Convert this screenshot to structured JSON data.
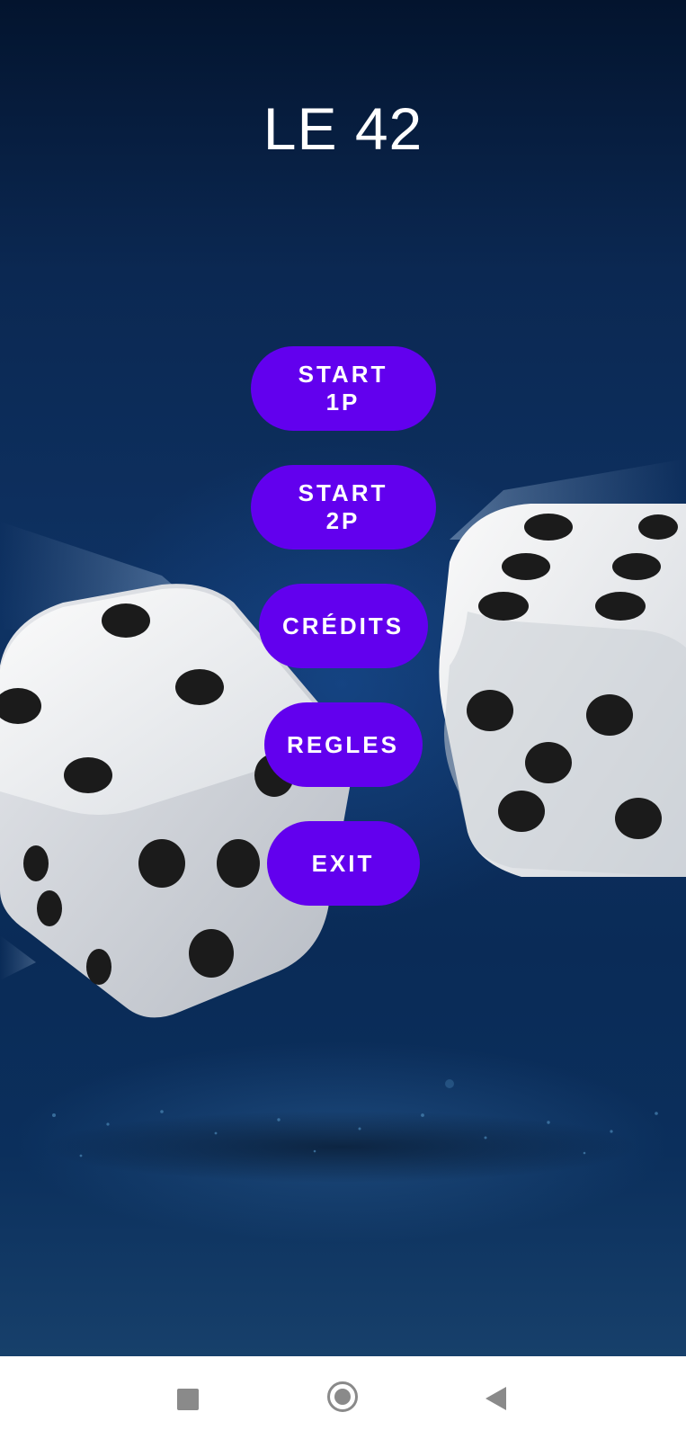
{
  "app": {
    "title": "LE 42"
  },
  "menu": {
    "start_1p_label": "START 1P",
    "start_2p_label": "START 2P",
    "credits_label": "CRÉDITS",
    "rules_label": "REGLES",
    "exit_label": "EXIT"
  },
  "colors": {
    "button_bg": "#6200ee",
    "button_text": "#ffffff",
    "title_text": "#ffffff",
    "background_dark_blue": "#0b2852"
  },
  "nav_bar": {
    "recents_icon": "square-icon",
    "home_icon": "circle-home-icon",
    "back_icon": "triangle-back-icon"
  }
}
